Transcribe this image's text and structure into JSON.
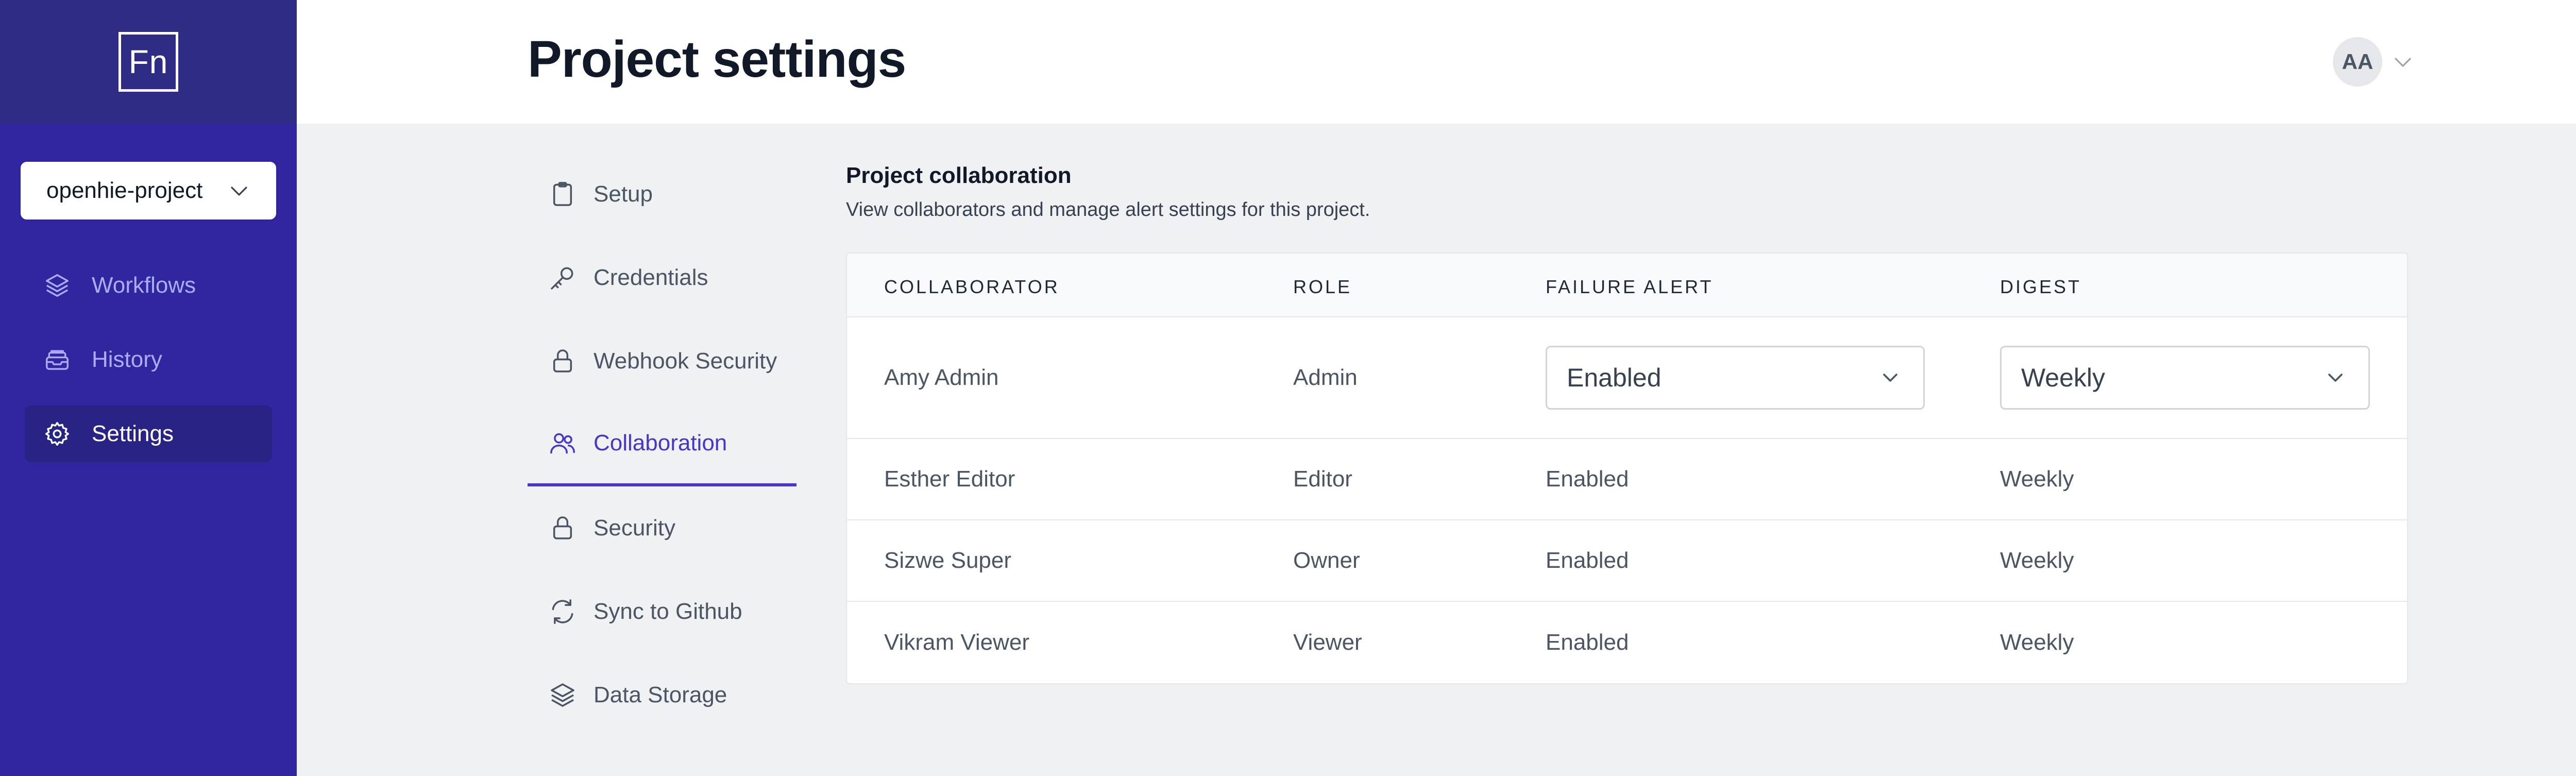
{
  "app": {
    "logo_text": "Fn",
    "project": "openhie-project"
  },
  "sidebar": {
    "items": [
      {
        "label": "Workflows",
        "icon": "layers-icon",
        "active": false
      },
      {
        "label": "History",
        "icon": "inbox-stack-icon",
        "active": false
      },
      {
        "label": "Settings",
        "icon": "gear-icon",
        "active": true
      }
    ]
  },
  "header": {
    "title": "Project settings",
    "avatar_initials": "AA"
  },
  "settings_nav": {
    "items": [
      {
        "label": "Setup",
        "icon": "clipboard-icon"
      },
      {
        "label": "Credentials",
        "icon": "key-icon"
      },
      {
        "label": "Webhook Security",
        "icon": "lock-icon"
      },
      {
        "label": "Collaboration",
        "icon": "users-icon",
        "active": true
      },
      {
        "label": "Security",
        "icon": "lock-icon"
      },
      {
        "label": "Sync to Github",
        "icon": "sync-icon"
      },
      {
        "label": "Data Storage",
        "icon": "layers-icon"
      }
    ]
  },
  "collaboration": {
    "title": "Project collaboration",
    "description": "View collaborators and manage alert settings for this project.",
    "columns": [
      "Collaborator",
      "Role",
      "Failure Alert",
      "Digest"
    ],
    "rows": [
      {
        "collaborator": "Amy Admin",
        "role": "Admin",
        "failure_alert": "Enabled",
        "digest": "Weekly",
        "editable": true
      },
      {
        "collaborator": "Esther Editor",
        "role": "Editor",
        "failure_alert": "Enabled",
        "digest": "Weekly"
      },
      {
        "collaborator": "Sizwe Super",
        "role": "Owner",
        "failure_alert": "Enabled",
        "digest": "Weekly"
      },
      {
        "collaborator": "Vikram Viewer",
        "role": "Viewer",
        "failure_alert": "Enabled",
        "digest": "Weekly"
      }
    ]
  },
  "colors": {
    "sidebar_bg": "#3126a0",
    "sidebar_top_bg": "#2e2c85",
    "accent": "#4338ca"
  }
}
